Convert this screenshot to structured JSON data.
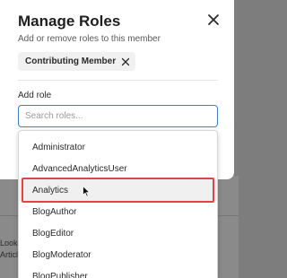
{
  "modal": {
    "title": "Manage Roles",
    "subtitle": "Add or remove roles to this member",
    "chips": [
      {
        "label": "Contributing Member"
      }
    ],
    "add_role_label": "Add role",
    "search": {
      "placeholder": "Search roles...",
      "value": ""
    }
  },
  "dropdown": {
    "options": [
      "Administrator",
      "AdvancedAnalyticsUser",
      "Analytics",
      "BlogAuthor",
      "BlogEditor",
      "BlogModerator",
      "BlogPublisher"
    ],
    "highlighted": "Analytics"
  },
  "background_page": {
    "fragments": [
      "Look",
      "Articl"
    ]
  },
  "icons": {
    "close": "close-icon",
    "chip_remove": "x-icon",
    "cursor": "pointer-cursor-icon"
  },
  "colors": {
    "focus_border": "#3b82c4",
    "highlight_outline": "#e04444"
  }
}
